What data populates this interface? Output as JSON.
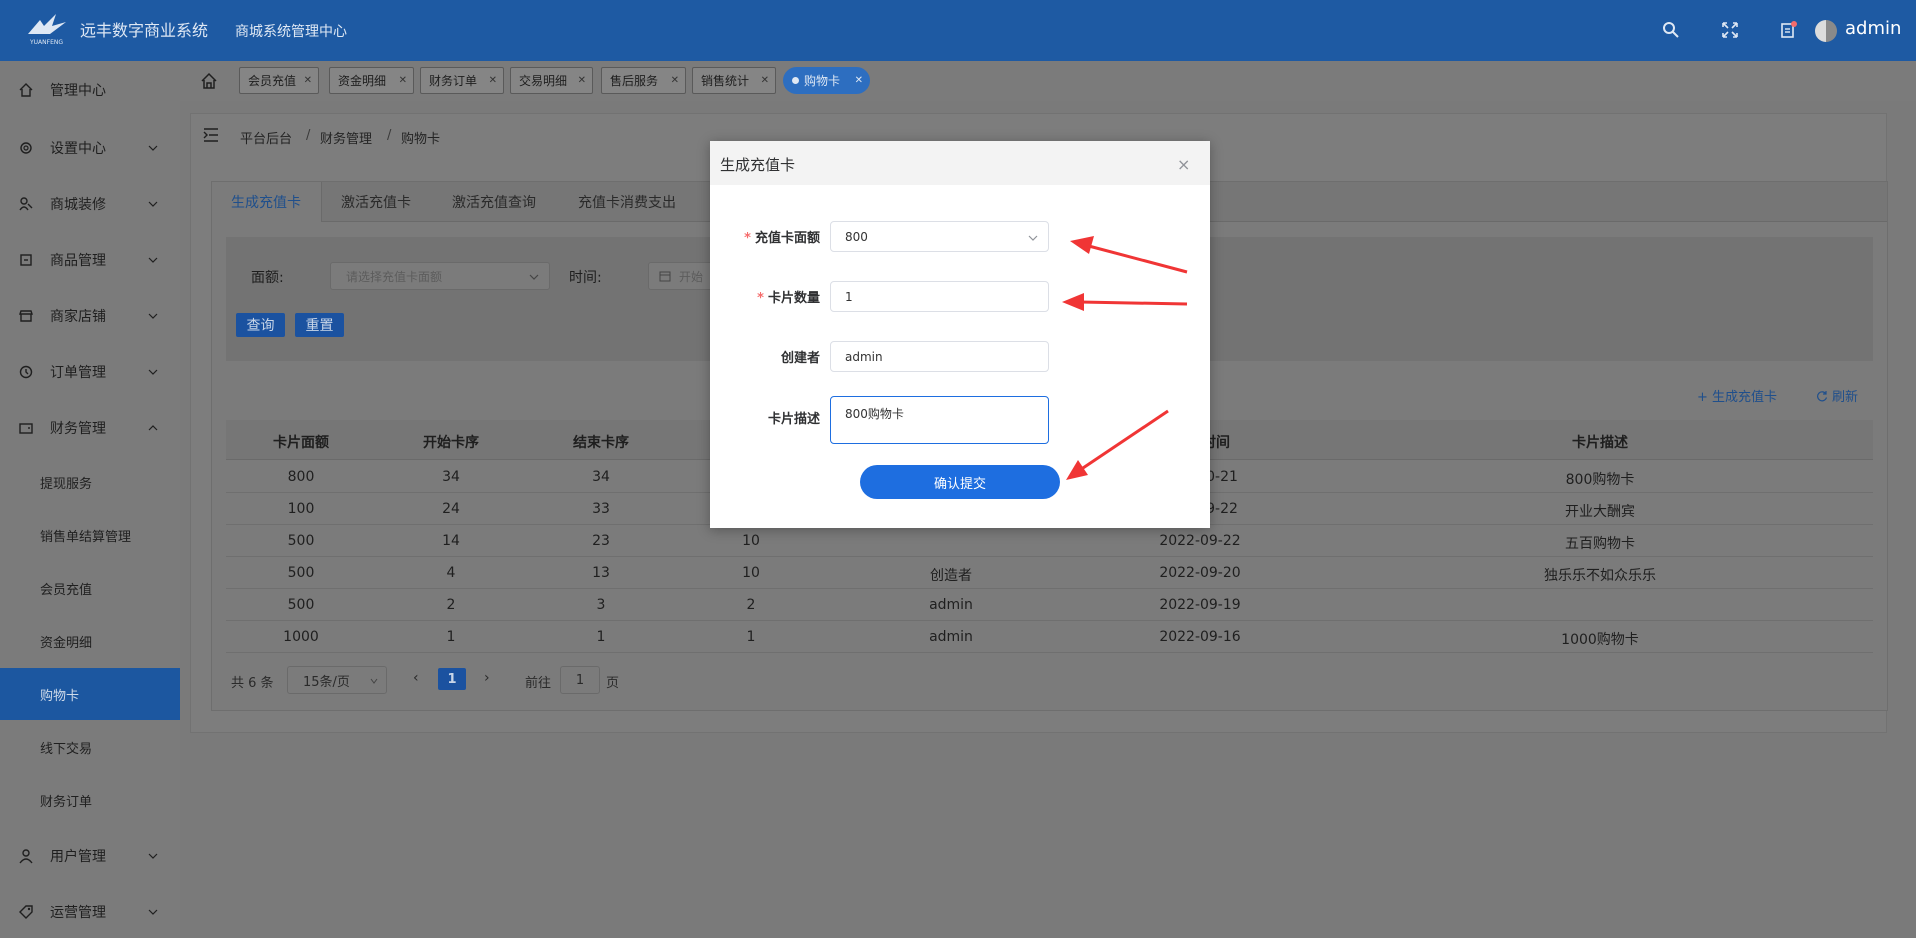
{
  "header": {
    "app_title": "远丰数字商业系统",
    "app_subtitle": "商城系统管理中心",
    "logo_text": "YUANFENG",
    "user": "admin"
  },
  "sidebar": {
    "items": [
      {
        "label": "管理中心",
        "icon": "home-icon"
      },
      {
        "label": "设置中心",
        "icon": "gear-icon"
      },
      {
        "label": "商城装修",
        "icon": "paint-icon"
      },
      {
        "label": "商品管理",
        "icon": "box-icon"
      },
      {
        "label": "商家店铺",
        "icon": "store-icon"
      },
      {
        "label": "订单管理",
        "icon": "order-icon"
      },
      {
        "label": "财务管理",
        "icon": "wallet-icon"
      },
      {
        "label": "用户管理",
        "icon": "user-icon"
      },
      {
        "label": "运营管理",
        "icon": "tag-icon"
      }
    ],
    "finance_sub": [
      {
        "label": "提现服务"
      },
      {
        "label": "销售单结算管理"
      },
      {
        "label": "会员充值"
      },
      {
        "label": "资金明细"
      },
      {
        "label": "购物卡"
      },
      {
        "label": "线下交易"
      },
      {
        "label": "财务订单"
      }
    ]
  },
  "page_tabs": [
    "会员充值",
    "资金明细",
    "财务订单",
    "交易明细",
    "售后服务",
    "销售统计",
    "购物卡"
  ],
  "breadcrumb": [
    "平台后台",
    "财务管理",
    "购物卡"
  ],
  "breadcrumb_sep": "/",
  "inner_tabs": [
    "生成充值卡",
    "激活充值卡",
    "激活充值查询",
    "充值卡消费支出"
  ],
  "filter": {
    "amount_label": "面额:",
    "amount_placeholder": "请选择充值卡面额",
    "time_label": "时间:",
    "date_placeholder": "开始",
    "query_button": "查询",
    "reset_button": "重置"
  },
  "toolbar": {
    "generate_label": "+ 生成充值卡",
    "refresh_label": "刷新"
  },
  "table": {
    "columns": [
      "卡片面额",
      "开始卡序",
      "结束卡序",
      "",
      "",
      "时间",
      "卡片描述"
    ],
    "rows": [
      {
        "value": "800",
        "start": "34",
        "end": "34",
        "count": "",
        "creator": "",
        "time": "0-21",
        "desc": "800购物卡"
      },
      {
        "value": "100",
        "start": "24",
        "end": "33",
        "count": "",
        "creator": "",
        "time": "9-22",
        "desc": "开业大酬宾"
      },
      {
        "value": "500",
        "start": "14",
        "end": "23",
        "count": "10",
        "creator": "",
        "time": "2022-09-22",
        "desc": "五百购物卡"
      },
      {
        "value": "500",
        "start": "4",
        "end": "13",
        "count": "10",
        "creator": "创造者",
        "time": "2022-09-20",
        "desc": "独乐乐不如众乐乐"
      },
      {
        "value": "500",
        "start": "2",
        "end": "3",
        "count": "2",
        "creator": "admin",
        "time": "2022-09-19",
        "desc": ""
      },
      {
        "value": "1000",
        "start": "1",
        "end": "1",
        "count": "1",
        "creator": "admin",
        "time": "2022-09-16",
        "desc": "1000购物卡"
      }
    ]
  },
  "pager": {
    "total": "共 6 条",
    "page_size": "15条/页",
    "current_page": "1",
    "goto_label": "前往",
    "goto_value": "1",
    "page_suffix": "页"
  },
  "dialog": {
    "title": "生成充值卡",
    "close": "×",
    "fields": {
      "amount_label": "充值卡面额",
      "amount_value": "800",
      "quantity_label": "卡片数量",
      "quantity_value": "1",
      "creator_label": "创建者",
      "creator_value": "admin",
      "desc_label": "卡片描述",
      "desc_value": "800购物卡"
    },
    "required_mark": "*",
    "submit": "确认提交"
  },
  "colors": {
    "header_bg": "#1e5aa3",
    "primary": "#1e6ee0",
    "annotation_arrow": "#f03535"
  }
}
